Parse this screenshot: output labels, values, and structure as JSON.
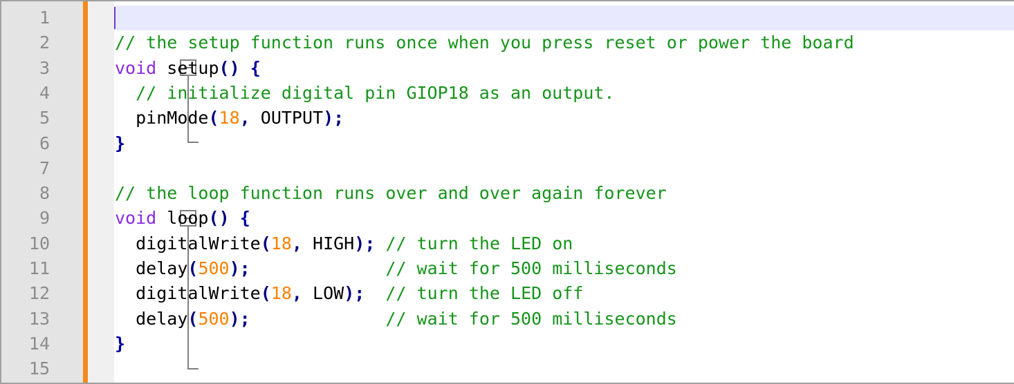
{
  "editor": {
    "line_numbers": [
      "1",
      "2",
      "3",
      "4",
      "5",
      "6",
      "7",
      "8",
      "9",
      "10",
      "11",
      "12",
      "13",
      "14",
      "15"
    ],
    "lines": [
      "",
      "// the setup function runs once when you press reset or power the board",
      "void setup() {",
      "  // initialize digital pin GIOP18 as an output.",
      "  pinMode(18, OUTPUT);",
      "}",
      "",
      "// the loop function runs over and over again forever",
      "void loop() {",
      "  digitalWrite(18, HIGH); // turn the LED on",
      "  delay(500);             // wait for 500 milliseconds",
      "  digitalWrite(18, LOW);  // turn the LED off",
      "  delay(500);             // wait for 500 milliseconds",
      "}",
      ""
    ]
  },
  "colors": {
    "comment": "#16941a",
    "keyword": "#8a2be2",
    "number": "#ff8000",
    "brace": "#0000a0",
    "change_bar": "#f28a1c",
    "current_line": "#e8e8ff",
    "line_number": "#8c8c8c"
  },
  "icons": {
    "fold": "fold-toggle-icon"
  }
}
